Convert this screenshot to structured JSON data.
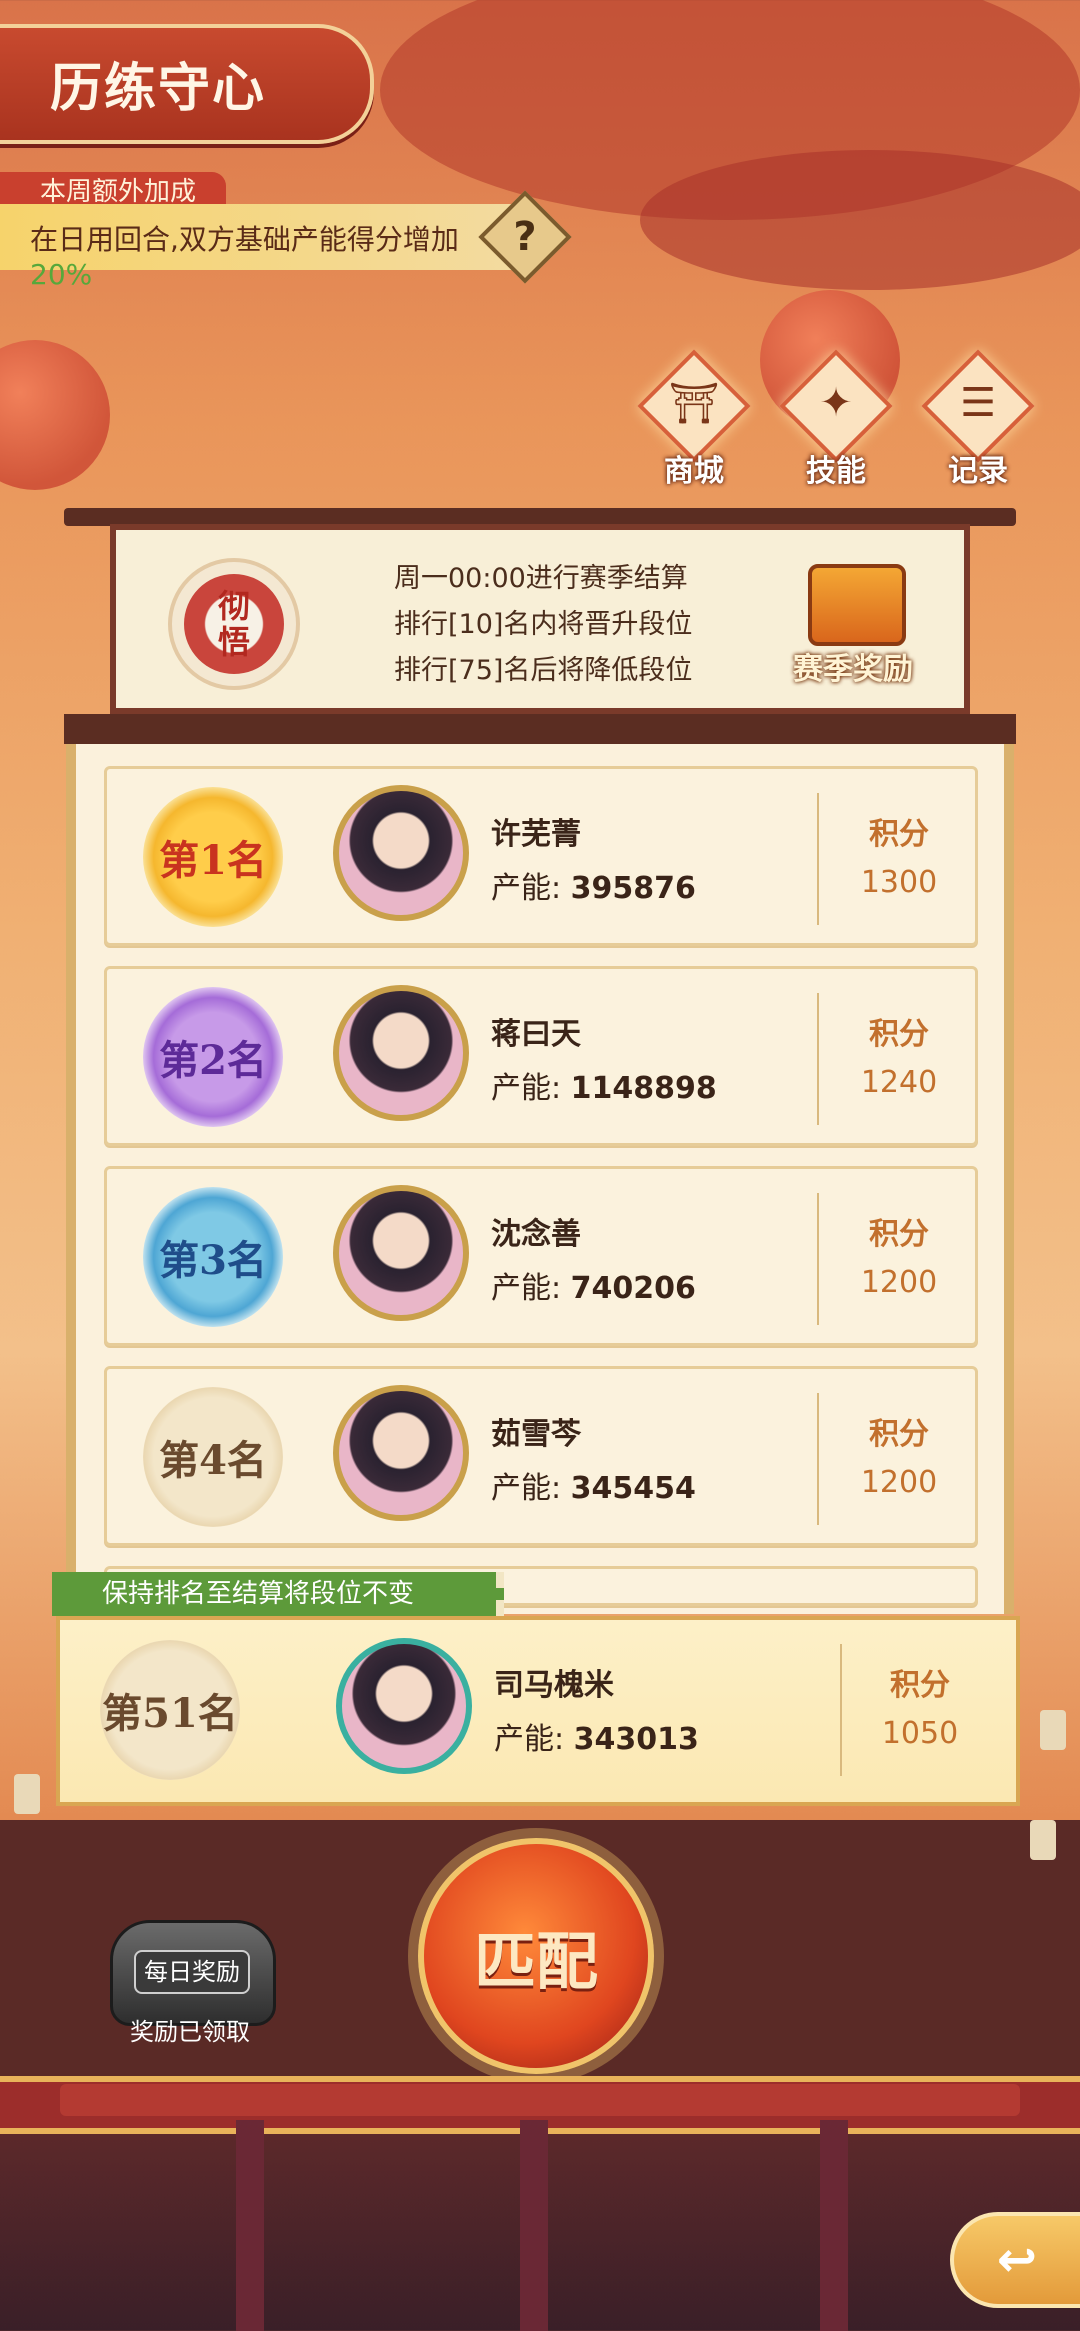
{
  "header": {
    "title": "历练守心",
    "bonus_tag": "本周额外加成",
    "bonus_text": "在日用回合,双方基础产能得分增加",
    "bonus_pct": "20%",
    "help_icon": "?"
  },
  "top_menu": [
    {
      "label": "商城",
      "icon": "shop-icon"
    },
    {
      "label": "技能",
      "icon": "skill-icon"
    },
    {
      "label": "记录",
      "icon": "record-icon"
    }
  ],
  "season": {
    "seal_chars": [
      "彻",
      "悟"
    ],
    "rules": [
      "周一00:00进行赛季结算",
      "排行[10]名内将晋升段位",
      "排行[75]名后将降低段位"
    ],
    "reward_label": "赛季奖励"
  },
  "labels": {
    "power_prefix": "产能: ",
    "score_label": "积分"
  },
  "ranking": [
    {
      "rank": "第1名",
      "name": "许芜菁",
      "power": "395876",
      "score": "1300"
    },
    {
      "rank": "第2名",
      "name": "蒋曰天",
      "power": "1148898",
      "score": "1240"
    },
    {
      "rank": "第3名",
      "name": "沈念善",
      "power": "740206",
      "score": "1200"
    },
    {
      "rank": "第4名",
      "name": "茹雪芩",
      "power": "345454",
      "score": "1200"
    }
  ],
  "keep_notice": "保持排名至结算将段位不变",
  "me": {
    "rank": "第51名",
    "name": "司马槐米",
    "power": "343013",
    "score": "1050",
    "avatar_tag": "TapTap"
  },
  "bottom": {
    "daily_label": "每日奖励",
    "daily_status": "奖励已领取",
    "match_label": "匹配",
    "back_icon": "back-arrow-icon"
  },
  "colors": {
    "accent_red": "#c9402e",
    "score_color": "#c2702d",
    "bonus_green": "#57a83b",
    "keep_banner_green": "#5d9a3a"
  }
}
